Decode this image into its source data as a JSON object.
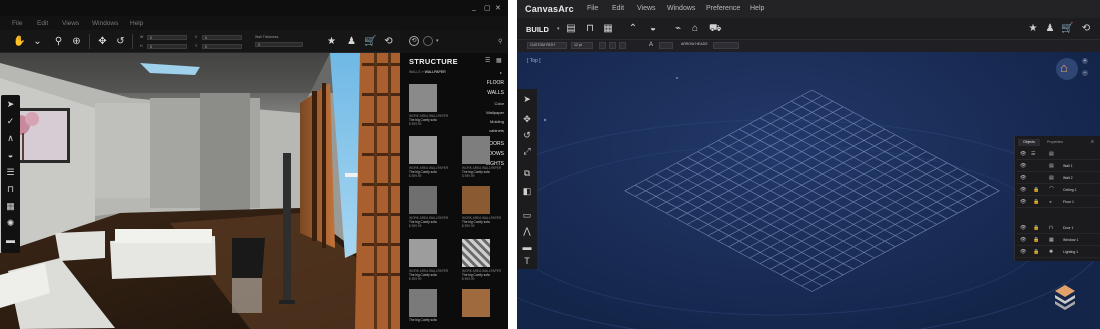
{
  "left_app": {
    "menu": [
      "File",
      "Edit",
      "Views",
      "Windows",
      "Help"
    ],
    "window_controls": [
      "_",
      "▢",
      "✕"
    ],
    "toolbar": {
      "field_labels": [
        "W",
        "H",
        "X",
        "Y",
        "Wall Thickness"
      ],
      "field_values": [
        "0",
        "0",
        "0",
        "0",
        "0"
      ]
    },
    "toolbar_icons": [
      "hand-icon",
      "orbit-icon",
      "zoom-icon",
      "target-icon",
      "move-icon",
      "rotate-icon"
    ],
    "right_icons": [
      "star-icon",
      "person-icon",
      "cart-icon",
      "history-icon"
    ],
    "side_icons": [
      "pointer-icon",
      "line-tool-icon",
      "angle-icon",
      "sofa-icon",
      "stairs-icon",
      "door-icon",
      "window-icon",
      "lamp-icon",
      "couch-icon"
    ],
    "structure": {
      "title": "STRUCTURE",
      "breadcrumb_parent": "WALLS",
      "breadcrumb_sep": "»",
      "breadcrumb_current": "WALLPAPER",
      "categories_top": [
        "FLOOR",
        "WALLS"
      ],
      "subcategories": [
        "Color",
        "Wallpaper",
        "Molding",
        "cabinets"
      ],
      "categories_bottom": [
        "DOORS",
        "WINDOWS",
        "LIGHTS"
      ],
      "swatches": [
        {
          "label": "WORK AREA WALLPAPER",
          "name": "The big Comfy sofa",
          "price": "$ 599.99"
        },
        {
          "label": "WORK AREA WALLPAPER",
          "name": "The big Comfy sofa",
          "price": "$ 599.99"
        },
        {
          "label": "WORK AREA WALLPAPER",
          "name": "The big Comfy sofa",
          "price": "$ 599.99"
        },
        {
          "label": "WORK AREA WALLPAPER",
          "name": "The big Comfy sofa",
          "price": "$ 599.99"
        },
        {
          "label": "WORK AREA WALLPAPER",
          "name": "The big Comfy sofa",
          "price": "$ 599.99"
        },
        {
          "label": "WORK AREA WALLPAPER",
          "name": "The big Comfy sofa",
          "price": "$ 599.99"
        },
        {
          "label": "WORK AREA WALLPAPER",
          "name": "The big Comfy sofa",
          "price": "$ 599.99"
        },
        {
          "label": "WORK AREA WALLPAPER",
          "name": "The big Comfy sofa",
          "price": "$ 599.99"
        }
      ]
    }
  },
  "right_app": {
    "logo": "CanvasArc",
    "menu": [
      "File",
      "Edit",
      "Views",
      "Windows",
      "Preference",
      "Help"
    ],
    "mode": "BUILD",
    "options": {
      "field1": "CUSTOM PATH",
      "field2": "12 pt",
      "field3": "ARROW HEADS"
    },
    "view_label": "[ Top ]",
    "objects_panel": {
      "tabs": [
        "Objects",
        "Properties"
      ],
      "rows": [
        "Wall 1",
        "Wall 2",
        "Ceiling 1",
        "Floor 1",
        "Door 1",
        "Window 1",
        "Lighting 1"
      ]
    },
    "colors": {
      "canvas": "#1a2e57",
      "grid": "#8da2cf"
    }
  }
}
